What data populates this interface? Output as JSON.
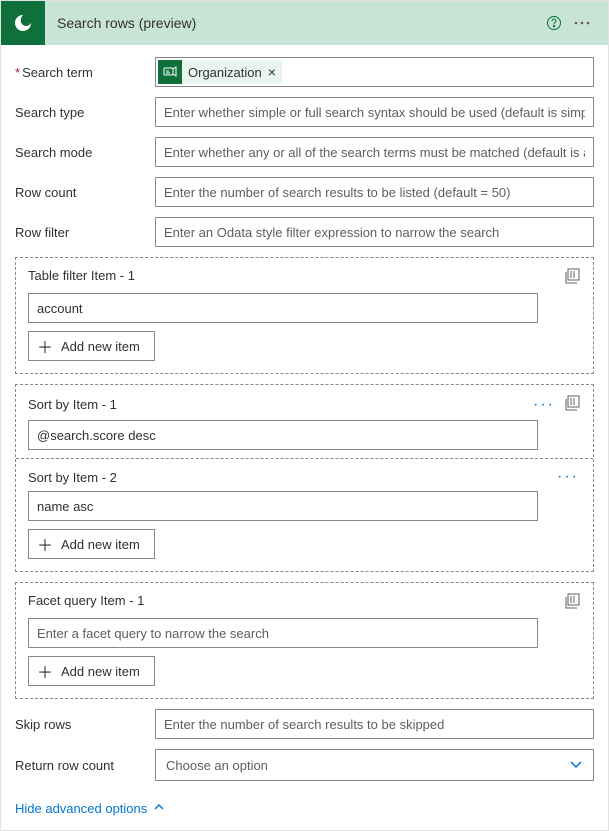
{
  "header": {
    "title": "Search rows (preview)"
  },
  "fields": {
    "search_term": {
      "label": "Search term",
      "token": "Organization"
    },
    "search_type": {
      "label": "Search type",
      "placeholder": "Enter whether simple or full search syntax should be used (default is simple)"
    },
    "search_mode": {
      "label": "Search mode",
      "placeholder": "Enter whether any or all of the search terms must be matched (default is any)"
    },
    "row_count": {
      "label": "Row count",
      "placeholder": "Enter the number of search results to be listed (default = 50)"
    },
    "row_filter": {
      "label": "Row filter",
      "placeholder": "Enter an Odata style filter expression to narrow the search"
    },
    "skip_rows": {
      "label": "Skip rows",
      "placeholder": "Enter the number of search results to be skipped"
    },
    "return_row_count": {
      "label": "Return row count",
      "placeholder": "Choose an option"
    }
  },
  "groups": {
    "table_filter": {
      "items": [
        {
          "label": "Table filter Item - 1",
          "value": "account"
        }
      ]
    },
    "sort_by": {
      "items": [
        {
          "label": "Sort by Item - 1",
          "value": "@search.score desc"
        },
        {
          "label": "Sort by Item - 2",
          "value": "name asc"
        }
      ]
    },
    "facet_query": {
      "items": [
        {
          "label": "Facet query Item - 1",
          "value": "",
          "placeholder": "Enter a facet query to narrow the search"
        }
      ]
    }
  },
  "buttons": {
    "add_new_item": "Add new item"
  },
  "links": {
    "hide_advanced": "Hide advanced options"
  }
}
